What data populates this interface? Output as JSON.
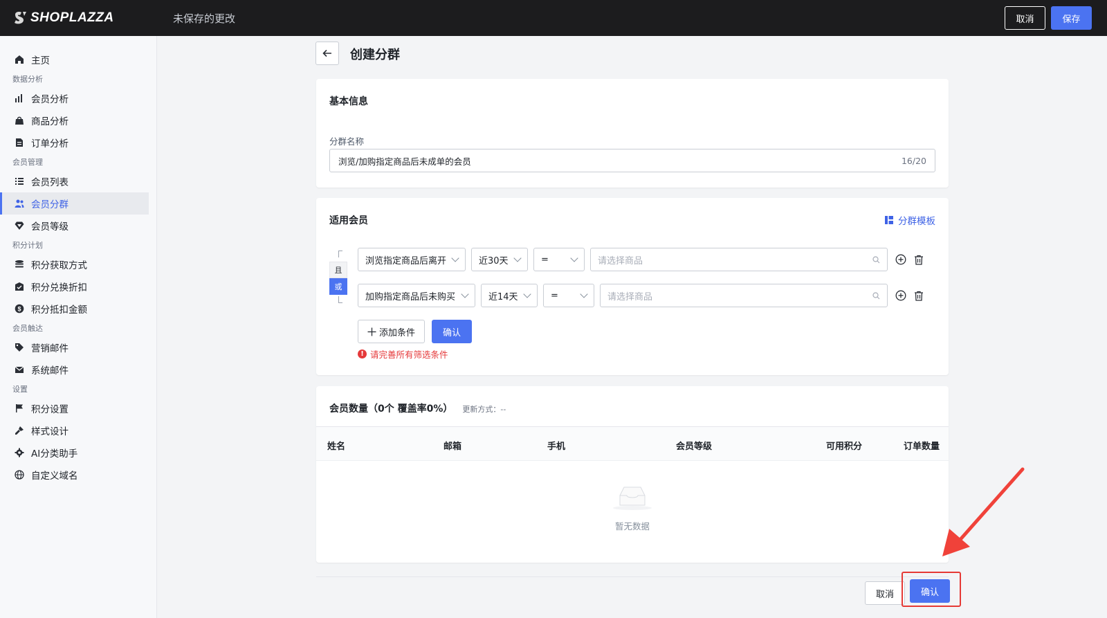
{
  "topbar": {
    "brand": "SHOPLAZZA",
    "status": "未保存的更改",
    "cancel_label": "取消",
    "save_label": "保存"
  },
  "sidebar": {
    "home": "主页",
    "sections": [
      {
        "title": "数据分析",
        "items": [
          "会员分析",
          "商品分析",
          "订单分析"
        ]
      },
      {
        "title": "会员管理",
        "items": [
          "会员列表",
          "会员分群",
          "会员等级"
        ]
      },
      {
        "title": "积分计划",
        "items": [
          "积分获取方式",
          "积分兑换折扣",
          "积分抵扣金额"
        ]
      },
      {
        "title": "会员触达",
        "items": [
          "营销邮件",
          "系统邮件"
        ]
      },
      {
        "title": "设置",
        "items": [
          "积分设置",
          "样式设计",
          "AI分类助手",
          "自定义域名"
        ]
      }
    ],
    "active_item": "会员分群"
  },
  "page": {
    "title": "创建分群"
  },
  "basic_info": {
    "title": "基本信息",
    "name_label": "分群名称",
    "name_value": "浏览/加购指定商品后未成单的会员",
    "name_counter": "16/20"
  },
  "members": {
    "title": "适用会员",
    "template_link": "分群模板",
    "logic_and": "且",
    "logic_or": "或",
    "logic_selected": "或",
    "conditions": [
      {
        "behavior": "浏览指定商品后离开",
        "period": "近30天",
        "operator": "=",
        "product_placeholder": "请选择商品"
      },
      {
        "behavior": "加购指定商品后未购买",
        "period": "近14天",
        "operator": "=",
        "product_placeholder": "请选择商品"
      }
    ],
    "add_condition_label": "添加条件",
    "confirm_label": "确认",
    "error": "请完善所有筛选条件"
  },
  "member_count": {
    "title": "会员数量（0个 覆盖率0%）",
    "update_label": "更新方式：--",
    "columns": [
      "姓名",
      "邮箱",
      "手机",
      "会员等级",
      "可用积分",
      "订单数量"
    ],
    "empty_text": "暂无数据"
  },
  "footer": {
    "cancel_label": "取消",
    "confirm_label": "确认"
  },
  "colors": {
    "accent": "#4b73f1",
    "topbar": "#1c1c1e",
    "error": "#e5393a",
    "annotation": "#e53935"
  }
}
